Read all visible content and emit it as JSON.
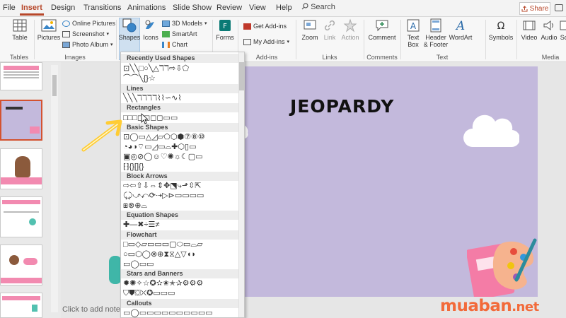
{
  "tabs": [
    "File",
    "Insert",
    "Design",
    "Transitions",
    "Animations",
    "Slide Show",
    "Review",
    "View",
    "Help"
  ],
  "active_tab": "Insert",
  "search_label": "Search",
  "share_label": "Share",
  "ribbon": {
    "table": "Table",
    "pictures": "Pictures",
    "online_pictures": "Online Pictures",
    "screenshot": "Screenshot",
    "photo_album": "Photo Album",
    "shapes": "Shapes",
    "icons": "Icons",
    "models_3d": "3D Models",
    "smartart": "SmartArt",
    "chart": "Chart",
    "forms": "Forms",
    "get_addins": "Get Add-ins",
    "my_addins": "My Add-ins",
    "zoom": "Zoom",
    "link": "Link",
    "action": "Action",
    "comment": "Comment",
    "text_box": "Text\nBox",
    "header_footer": "Header\n& Footer",
    "wordart": "WordArt",
    "symbols": "Symbols",
    "video": "Video",
    "audio": "Audio",
    "screen": "Sc",
    "groups": {
      "tables": "Tables",
      "images": "Images",
      "addins": "Add-ins",
      "links": "Links",
      "comments": "Comments",
      "text": "Text",
      "media": "Media"
    }
  },
  "shapes_menu": {
    "categories": [
      {
        "name": "Recently Used Shapes",
        "rows": [
          "⊡╲╲□○╲△ℸℸ⇨⇩⬠",
          "⌒⌒╲{}☆"
        ]
      },
      {
        "name": "Lines",
        "rows": [
          "╲╲╲ℸℸℸℸ⌇⌇∽∿⌇"
        ]
      },
      {
        "name": "Rectangles",
        "rows": [
          "□□□◻◻◻◻▭▭"
        ]
      },
      {
        "name": "Basic Shapes",
        "rows": [
          "⊡◯▭△◿▱⬠⬡⬢⑦⑧⑩",
          "◔◕◑⌔▭◿▭⌓✚⬡▯▭",
          "▣◎⊘◯☺♡✺☼☾▢▭",
          "⁅⁆{}[]{}"
        ]
      },
      {
        "name": "Block Arrows",
        "rows": [
          "⇨⇦⇧⇩⇔⇕✥⬔⤷⬏⇳⇱",
          "⤹⤸⤻⤺⟳⇢▷⊳▭▭▭▭",
          "⧆⊗⊕⌓"
        ]
      },
      {
        "name": "Equation Shapes",
        "rows": [
          "✚—✖÷☰≠"
        ]
      },
      {
        "name": "Flowchart",
        "rows": [
          "□▭◇▱▭▭▭▢⬭▭⌓▱",
          "○▭⬡◯⊗⊕⧗⧖△▽◖◗",
          "▭◯▭▭"
        ]
      },
      {
        "name": "Stars and Banners",
        "rows": [
          "✹✺✧☆✪✫✬✭✰⚙⚙⚙",
          "⛉⛊⛋⛌✪▭▭▭"
        ]
      },
      {
        "name": "Callouts",
        "rows": [
          "▭◯▭▭▭▭▭▭▭▭▭▭"
        ]
      }
    ]
  },
  "slide": {
    "title": "JEOPARDY"
  },
  "notes_placeholder": "Click to add notes",
  "watermark": {
    "text": "muaban",
    "domain": ".net"
  },
  "colors": {
    "accent": "#b7472a",
    "slide_bg": "#c3b9dc",
    "thumb_pink": "#f28ab0",
    "selection": "#d35230"
  }
}
